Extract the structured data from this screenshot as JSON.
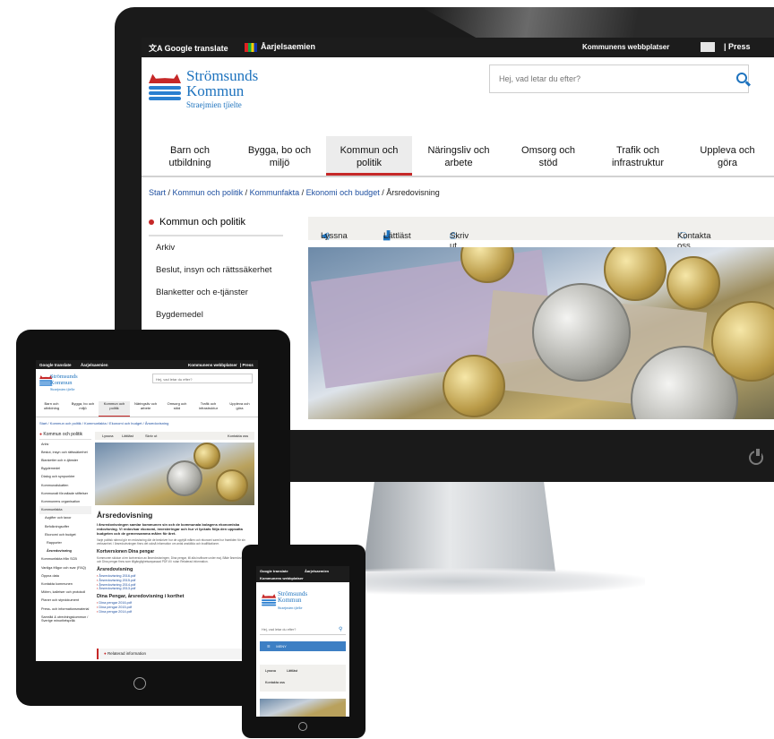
{
  "desktop": {
    "topbar": {
      "google_translate": "Google translate",
      "sami": "Åarjelsaemien",
      "municipal_sites": "Kommunens webbplatser",
      "press": "| Press"
    },
    "logo": {
      "name_line1": "Strömsunds",
      "name_line2": "Kommun",
      "subtitle": "Straejmien tjïelte"
    },
    "search": {
      "placeholder": "Hej, vad letar du efter?"
    },
    "nav": [
      {
        "line1": "Barn och",
        "line2": "utbildning"
      },
      {
        "line1": "Bygga, bo och",
        "line2": "miljö"
      },
      {
        "line1": "Kommun och",
        "line2": "politik"
      },
      {
        "line1": "Näringsliv och",
        "line2": "arbete"
      },
      {
        "line1": "Omsorg och",
        "line2": "stöd"
      },
      {
        "line1": "Trafik och",
        "line2": "infrastruktur"
      },
      {
        "line1": "Uppleva och",
        "line2": "göra"
      }
    ],
    "breadcrumb": {
      "start": "Start",
      "kommun": "Kommun och politik",
      "kommunfakta": "Kommunfakta",
      "ekonomi": "Ekonomi och budget",
      "current": "Årsredovisning"
    },
    "sidebar": {
      "heading": "Kommun och politik",
      "links": [
        "Arkiv",
        "Beslut, insyn och rättssäkerhet",
        "Blanketter och e-tjänster",
        "Bygdemedel"
      ]
    },
    "tools": {
      "listen": "Lyssna",
      "easy_read": "Lättläst",
      "print": "Skriv ut",
      "contact": "Kontakta oss"
    }
  },
  "tablet": {
    "topbar": {
      "google_translate": "Google translate",
      "sami": "Åarjelsaemien",
      "municipal_sites": "Kommunens webbplatser",
      "press": "| Press"
    },
    "logo": {
      "name_line1": "Strömsunds",
      "name_line2": "Kommun",
      "subtitle": "Straejmien tjïelte"
    },
    "search": {
      "placeholder": "Hej, vad letar du efter?"
    },
    "nav": [
      {
        "line1": "Barn och",
        "line2": "utbildning"
      },
      {
        "line1": "Bygga, bo och",
        "line2": "miljö"
      },
      {
        "line1": "Kommun och",
        "line2": "politik"
      },
      {
        "line1": "Näringsliv och",
        "line2": "arbete"
      },
      {
        "line1": "Omsorg och",
        "line2": "stöd"
      },
      {
        "line1": "Trafik och",
        "line2": "infrastruktur"
      },
      {
        "line1": "Uppleva och",
        "line2": "göra"
      }
    ],
    "breadcrumb": "Start / Kommun och politik / Kommunfakta / Ekonomi och budget / Årsredovisning",
    "sidebar": {
      "heading": "Kommun och politik",
      "links": [
        "Arkiv",
        "Beslut, insyn och rättssäkerhet",
        "Blanketter och e-tjänster",
        "Bygdemedel",
        "Dialog och synpunkter",
        "Kommunalskatten",
        "Kommunalt förvaltade stiftelser",
        "Kommunens organisation",
        "Kommunfakta"
      ],
      "sub_links": [
        "Avgifter och taxor",
        "Befolkningsoffer",
        "Ekonomi och budget",
        "Rapporter"
      ],
      "current": "Årsredovisning",
      "more_links": [
        "Kommunfakta från SCB",
        "Vanliga frågor och svar (FAQ)",
        "Öppna data",
        "Kontakta kommunen",
        "Möten, kallelser och protokoll",
        "Planer och styrdokument",
        "Press- och informationsmaterial",
        "Samråd & utredningskommun / Sverige minoritetspråk"
      ]
    },
    "tools": {
      "listen": "Lyssna",
      "easy_read": "Lättläst",
      "print": "Skriv ut",
      "contact": "Kontakta oss"
    },
    "content": {
      "title": "Årsredovisning",
      "lead": "I årsredovisningen samlar kommunen sin och de kommunala bolagens ekonomiska redovisning. Vi redovisar ekonomi, investeringar och hur vi lyckats följa den uppsatta budgeten och de gemensamma målen för året.",
      "para": "Varje politisk nämnd gör en redovisning där de beskriver hur de uppfyllt målen och ekonomi samt hur framtiden för sin verksamhet. I årsredovisningen finns det också information om antal anställda och kvalifikationer.",
      "short_heading": "Kortversionen Dina pengar",
      "short_para": "Kommunen skickar ut en kortversion av årsredovisningen, Dina pengar, till alla invånare under maj. Både årsredovisningen och Dina pengar finns som tillgänglighetsanpassad PDF-fil i rutan Relaterad information.",
      "annual_heading": "Årsredovisning",
      "annual_pdfs": [
        "Årsredovisning 2016.pdf",
        "Årsredovisning 2015.pdf",
        "Årsredovisning 2014.pdf",
        "Årsredovisning 2013.pdf"
      ],
      "dina_heading": "Dina Pengar, årsredovisning i korthet",
      "dina_pdfs": [
        "Dina pengar 2016.pdf",
        "Dina pengar 2015.pdf",
        "Dina pengar 2014.pdf"
      ],
      "related": "Relaterad information"
    }
  },
  "phone": {
    "topbar": {
      "google_translate": "Google translate",
      "sami": "Åarjelsaemien",
      "municipal_sites": "Kommunens webbplatser"
    },
    "logo": {
      "name_line1": "Strömsunds",
      "name_line2": "Kommun",
      "subtitle": "Straejmien tjïelte"
    },
    "search": {
      "placeholder": "Hej, vad letar du efter?"
    },
    "menu": "MENY",
    "tools": {
      "listen": "Lyssna",
      "easy_read": "Lättläst",
      "contact": "Kontakta oss"
    }
  },
  "colors": {
    "brand_blue": "#1e73be",
    "accent_red": "#c62828",
    "topbar": "#1c1c1c"
  }
}
